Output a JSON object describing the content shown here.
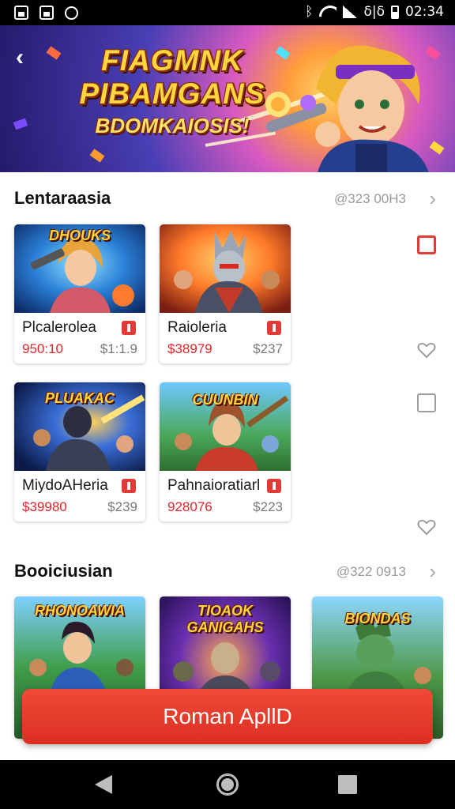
{
  "status_bar": {
    "network_label": "ᛒ",
    "signal_label": "δ|δ",
    "time": "02:34"
  },
  "banner": {
    "title_line1": "FIAGMNK",
    "title_line2": "PIBAMGANS",
    "title_line3": "BDOMKAIOSIS!"
  },
  "sections": [
    {
      "title": "Lentaraasia",
      "meta": "@323 00H3"
    },
    {
      "title": "Booiciusian",
      "meta": "@322 0913"
    }
  ],
  "cards": [
    {
      "art_title": "DHOUKS",
      "name": "Plcalerolea",
      "price": "950:10",
      "alt_price": "$1:1.9"
    },
    {
      "art_title": "",
      "name": "Raioleria",
      "price": "$38979",
      "alt_price": "$237"
    },
    {
      "art_title": "PLUAKAC",
      "name": "MiydoAHeria",
      "price": "$39980",
      "alt_price": "$239"
    },
    {
      "art_title": "CUUNBIN",
      "name": "Pahnaioratiarl",
      "price": "928076",
      "alt_price": "$223"
    },
    {
      "art_title": "RHONOAWIA",
      "name": "",
      "price": "",
      "alt_price": ""
    },
    {
      "art_title": "TIOAOK GANIGAHS",
      "name": "",
      "price": "",
      "alt_price": ""
    },
    {
      "art_title": "BIONDAS",
      "name": "",
      "price": "",
      "alt_price": ""
    }
  ],
  "cta": {
    "label": "Roman ApllD"
  },
  "colors": {
    "accent": "#e53935",
    "price": "#e0262a"
  },
  "icons": [
    "back-arrow-icon",
    "chevron-right-icon",
    "square-checkbox-icon",
    "heart-icon",
    "nav-back-icon",
    "nav-home-icon",
    "nav-recents-icon"
  ]
}
